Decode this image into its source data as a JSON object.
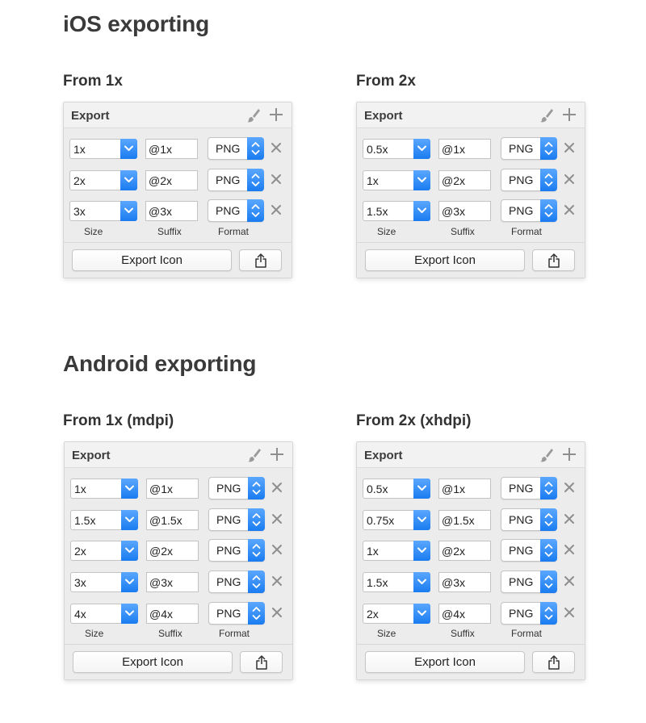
{
  "ios": {
    "title": "iOS exporting",
    "panels": [
      {
        "heading": "From 1x",
        "header": "Export",
        "rows": [
          {
            "size": "1x",
            "suffix": "@1x",
            "format": "PNG"
          },
          {
            "size": "2x",
            "suffix": "@2x",
            "format": "PNG"
          },
          {
            "size": "3x",
            "suffix": "@3x",
            "format": "PNG"
          }
        ],
        "labels": {
          "size": "Size",
          "suffix": "Suffix",
          "format": "Format"
        },
        "export_button": "Export Icon"
      },
      {
        "heading": "From 2x",
        "header": "Export",
        "rows": [
          {
            "size": "0.5x",
            "suffix": "@1x",
            "format": "PNG"
          },
          {
            "size": "1x",
            "suffix": "@2x",
            "format": "PNG"
          },
          {
            "size": "1.5x",
            "suffix": "@3x",
            "format": "PNG"
          }
        ],
        "labels": {
          "size": "Size",
          "suffix": "Suffix",
          "format": "Format"
        },
        "export_button": "Export Icon"
      }
    ]
  },
  "android": {
    "title": "Android exporting",
    "panels": [
      {
        "heading": "From 1x (mdpi)",
        "header": "Export",
        "rows": [
          {
            "size": "1x",
            "suffix": "@1x",
            "format": "PNG"
          },
          {
            "size": "1.5x",
            "suffix": "@1.5x",
            "format": "PNG"
          },
          {
            "size": "2x",
            "suffix": "@2x",
            "format": "PNG"
          },
          {
            "size": "3x",
            "suffix": "@3x",
            "format": "PNG"
          },
          {
            "size": "4x",
            "suffix": "@4x",
            "format": "PNG"
          }
        ],
        "labels": {
          "size": "Size",
          "suffix": "Suffix",
          "format": "Format"
        },
        "export_button": "Export Icon"
      },
      {
        "heading": "From 2x (xhdpi)",
        "header": "Export",
        "rows": [
          {
            "size": "0.5x",
            "suffix": "@1x",
            "format": "PNG"
          },
          {
            "size": "0.75x",
            "suffix": "@1.5x",
            "format": "PNG"
          },
          {
            "size": "1x",
            "suffix": "@2x",
            "format": "PNG"
          },
          {
            "size": "1.5x",
            "suffix": "@3x",
            "format": "PNG"
          },
          {
            "size": "2x",
            "suffix": "@4x",
            "format": "PNG"
          }
        ],
        "labels": {
          "size": "Size",
          "suffix": "Suffix",
          "format": "Format"
        },
        "export_button": "Export Icon"
      }
    ]
  },
  "icons": {
    "header_tools": [
      "brush-icon",
      "plus-icon"
    ],
    "row_remove": "close-icon",
    "footer_share": "share-icon",
    "select_indicator": "chevron-down-icon",
    "stepper_indicator": "up-down-chevron-icon"
  },
  "colors": {
    "accent": "#1a7cf0",
    "panel_background": "#ececec",
    "icon_gray": "#8e8e8e"
  }
}
